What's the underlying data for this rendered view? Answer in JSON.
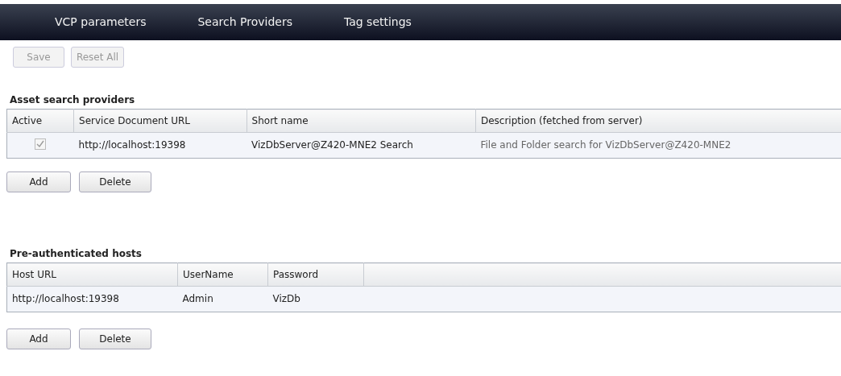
{
  "tabs": [
    {
      "label": "VCP parameters",
      "selected": false
    },
    {
      "label": "Search Providers",
      "selected": false
    },
    {
      "label": "Tag settings",
      "selected": false
    }
  ],
  "toolbar": [
    {
      "label": "Save",
      "disabled": true
    },
    {
      "label": "Reset All",
      "disabled": true
    }
  ],
  "asset_search_providers": {
    "title": "Asset search providers",
    "columns": [
      "Active",
      "Service Document URL",
      "Short name",
      "Description (fetched from server)"
    ],
    "rows": [
      {
        "active": {
          "checked": true,
          "disabled": true
        },
        "url": "http://localhost:19398",
        "short_name": "VizDbServer@Z420-MNE2 Search",
        "description": "File and Folder search for VizDbServer@Z420-MNE2"
      }
    ],
    "buttons": [
      {
        "label": "Add",
        "disabled": false
      },
      {
        "label": "Delete",
        "disabled": false
      }
    ]
  },
  "pre_authenticated_hosts": {
    "title": "Pre-authenticated hosts",
    "columns": [
      "Host URL",
      "UserName",
      "Password"
    ],
    "rows": [
      [
        "http://localhost:19398",
        "Admin",
        "VizDb"
      ]
    ],
    "buttons": [
      {
        "label": "Add",
        "disabled": false
      },
      {
        "label": "Delete",
        "disabled": false
      }
    ]
  }
}
